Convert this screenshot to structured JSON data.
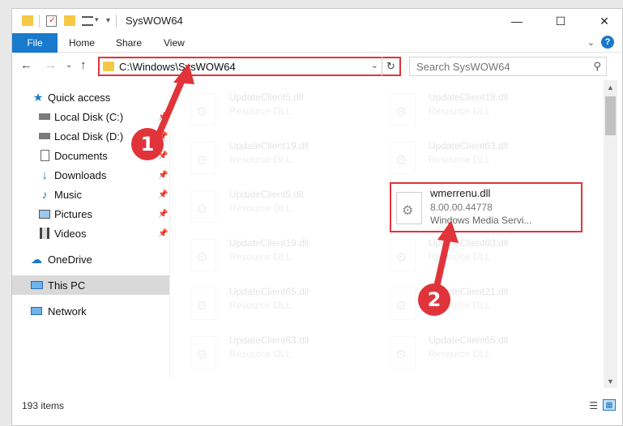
{
  "window": {
    "title": "SysWOW64",
    "controls": {
      "minimize": "—",
      "maximize": "☐",
      "close": "✕"
    }
  },
  "ribbon": {
    "tabs": [
      "File",
      "Home",
      "Share",
      "View"
    ],
    "help": "?"
  },
  "address_bar": {
    "path": "C:\\Windows\\SysWOW64",
    "dropdown": "⌄",
    "refresh": "↻"
  },
  "search": {
    "placeholder": "Search SysWOW64"
  },
  "sidebar": {
    "items": [
      {
        "label": "Quick access",
        "icon": "star-icon"
      },
      {
        "label": "Local Disk (C:)",
        "icon": "drive-icon",
        "pinned": true
      },
      {
        "label": "Local Disk (D:)",
        "icon": "drive-icon",
        "pinned": true
      },
      {
        "label": "Documents",
        "icon": "documents-icon",
        "pinned": true
      },
      {
        "label": "Downloads",
        "icon": "download-icon",
        "pinned": true
      },
      {
        "label": "Music",
        "icon": "music-icon",
        "pinned": true
      },
      {
        "label": "Pictures",
        "icon": "pictures-icon",
        "pinned": true
      },
      {
        "label": "Videos",
        "icon": "videos-icon",
        "pinned": true
      },
      {
        "label": "OneDrive",
        "icon": "cloud-icon"
      },
      {
        "label": "This PC",
        "icon": "computer-icon",
        "selected": true
      },
      {
        "label": "Network",
        "icon": "network-icon"
      }
    ]
  },
  "files": {
    "left": [
      {
        "name": "UpdateClient5.dll",
        "type": "Resource DLL"
      },
      {
        "name": "UpdateClient19.dll",
        "type": "Resource DLL"
      },
      {
        "name": "UpdateClient5.dll",
        "type": "Resource DLL"
      },
      {
        "name": "UpdateClient19.dll",
        "type": "Resource DLL"
      },
      {
        "name": "UpdateClient65.dll",
        "type": "Resource DLL"
      },
      {
        "name": "UpdateClient63.dll",
        "type": "Resource DLL"
      }
    ],
    "right": [
      {
        "name": "UpdateClient19.dll",
        "type": "Resource DLL"
      },
      {
        "name": "UpdateClient63.dll",
        "type": "Resource DLL"
      },
      {
        "name": "UpdateClient63.dll",
        "type": "Resource DLL"
      },
      {
        "name": "UpdateClient21.dll",
        "type": "Resource DLL"
      },
      {
        "name": "UpdateClient65.dll",
        "type": "Resource DLL"
      }
    ],
    "highlighted": {
      "name": "wmerrenu.dll",
      "version": "8.00.00.44778",
      "description": "Windows Media Servi..."
    }
  },
  "status": {
    "count": "193 items"
  },
  "annotations": {
    "step1": "1",
    "step2": "2",
    "color": "#e0343a"
  }
}
